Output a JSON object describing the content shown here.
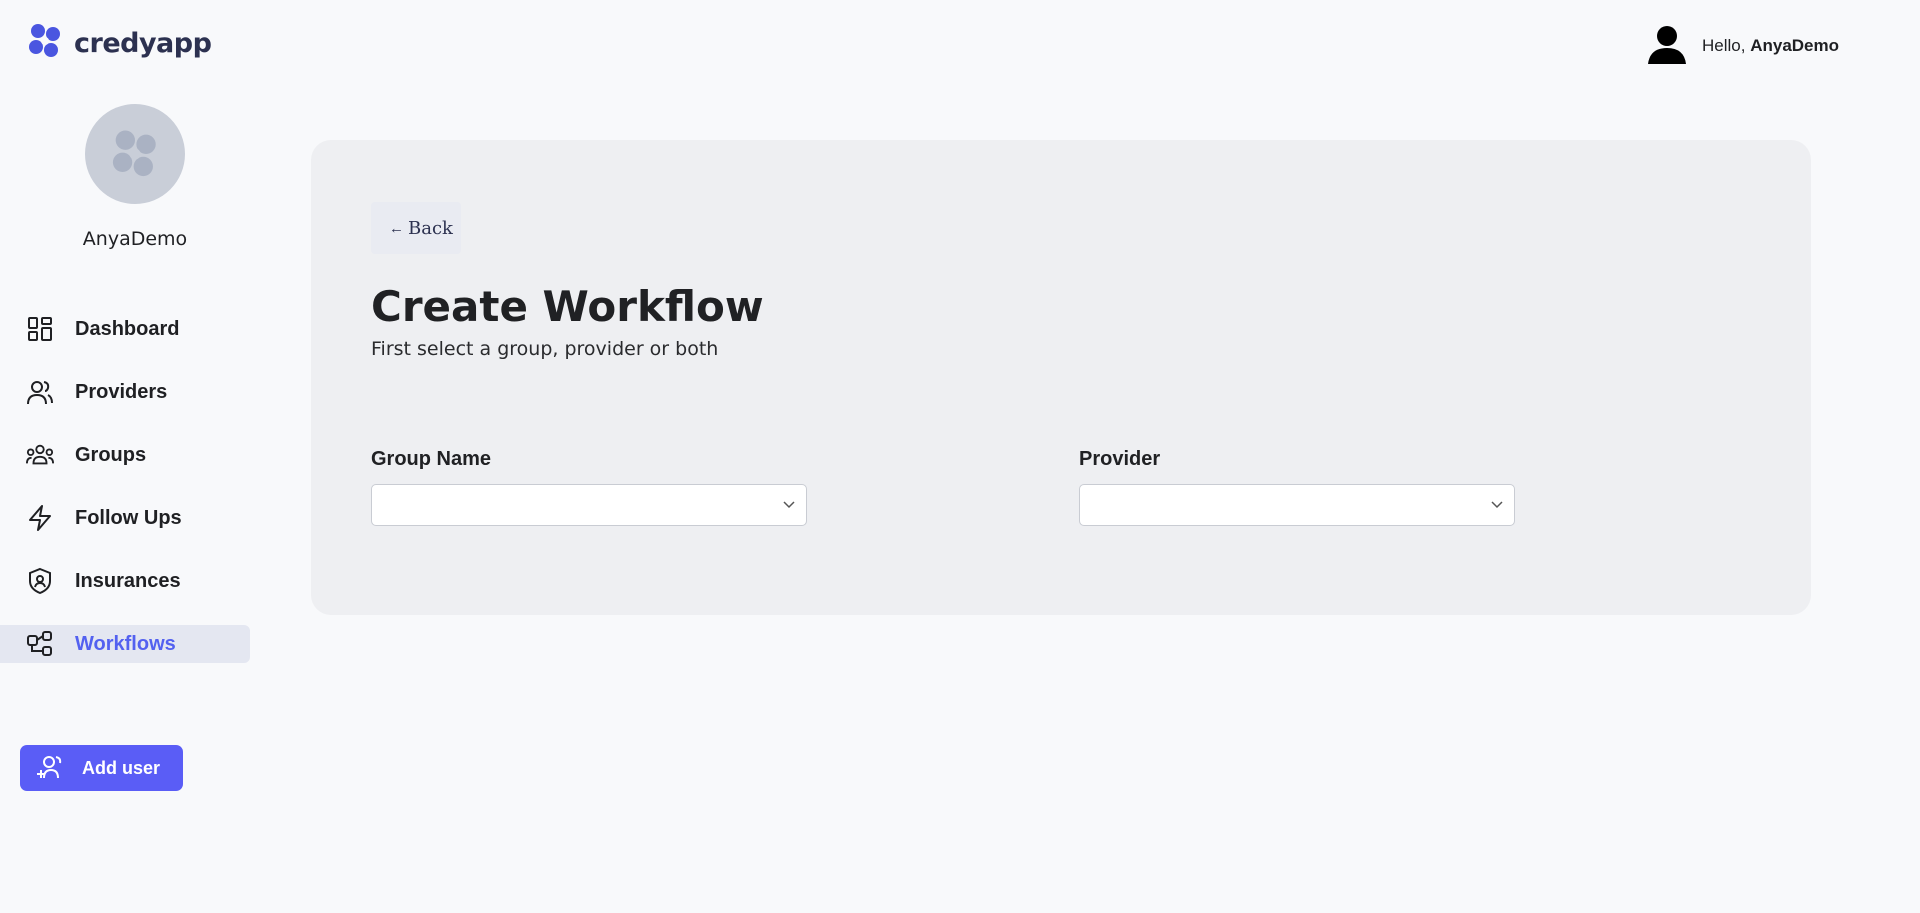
{
  "header": {
    "logo_text": "credyapp",
    "greeting_prefix": "Hello,",
    "greeting_name": "AnyaDemo"
  },
  "sidebar": {
    "profile_name": "AnyaDemo",
    "items": [
      {
        "label": "Dashboard",
        "icon": "dashboard-icon"
      },
      {
        "label": "Providers",
        "icon": "providers-icon"
      },
      {
        "label": "Groups",
        "icon": "groups-icon"
      },
      {
        "label": "Follow Ups",
        "icon": "lightning-icon"
      },
      {
        "label": "Insurances",
        "icon": "shield-icon"
      },
      {
        "label": "Workflows",
        "icon": "workflow-icon",
        "active": true
      }
    ],
    "add_user_label": "Add user"
  },
  "main": {
    "back_label": "Back",
    "title": "Create Workflow",
    "subtitle": "First select a group, provider or both",
    "group_field": {
      "label": "Group Name",
      "value": ""
    },
    "provider_field": {
      "label": "Provider",
      "value": ""
    }
  },
  "colors": {
    "accent": "#5a5df6",
    "active_text": "#5361f0",
    "active_bg": "#e4e7f1",
    "card_bg": "#eeeff2",
    "page_bg": "#f8f9fb"
  }
}
